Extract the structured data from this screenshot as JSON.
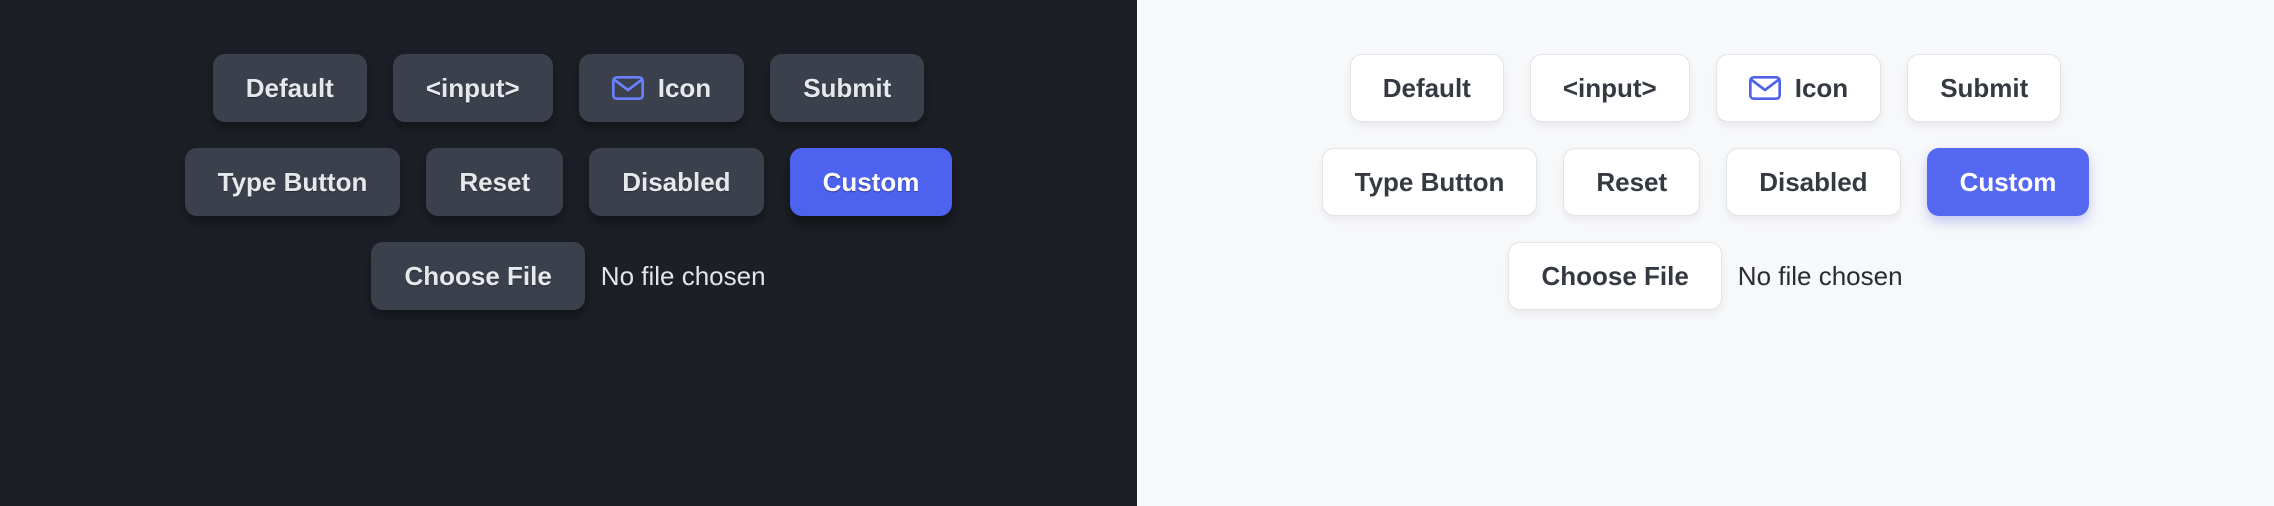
{
  "buttons": {
    "default": "Default",
    "input": "<input>",
    "icon": "Icon",
    "submit": "Submit",
    "type_button": "Type Button",
    "reset": "Reset",
    "disabled": "Disabled",
    "custom": "Custom",
    "choose_file": "Choose File"
  },
  "file": {
    "status": "No file chosen"
  },
  "colors": {
    "dark_bg": "#1c1f26",
    "dark_btn": "#3b414c",
    "light_bg": "#f7f8fa",
    "light_btn": "#ffffff",
    "accent": "#5568f2",
    "icon_accent": "#4f63ea"
  }
}
